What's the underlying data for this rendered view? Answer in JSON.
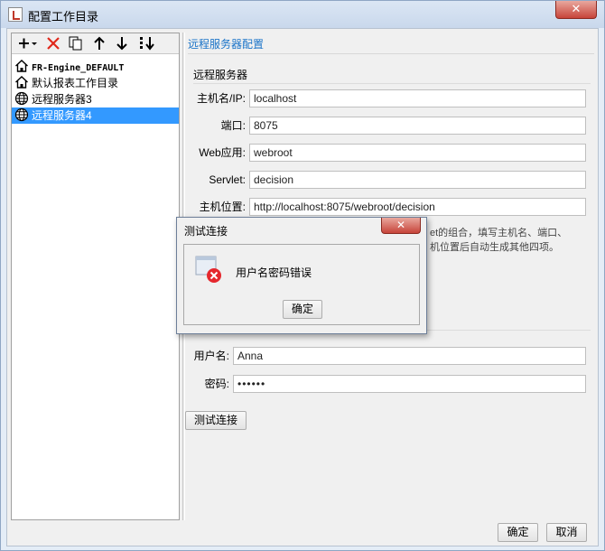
{
  "window": {
    "title": "配置工作目录",
    "close_glyph": "✕"
  },
  "toolbar": {
    "add_icon": "plus-icon",
    "delete_icon": "red-x-icon",
    "copy_icon": "copy-icon",
    "up_icon": "arrow-up-icon",
    "down_icon": "arrow-down-icon",
    "sort_icon": "sort-icon"
  },
  "tree": {
    "items": [
      {
        "label": "FR-Engine_DEFAULT",
        "icon": "home-icon"
      },
      {
        "label": "默认报表工作目录",
        "icon": "home-icon"
      },
      {
        "label": "远程服务器3",
        "icon": "globe-icon"
      },
      {
        "label": "远程服务器4",
        "icon": "globe-icon",
        "selected": true
      }
    ]
  },
  "config": {
    "section_title": "远程服务器配置",
    "server_group": "远程服务器",
    "hostname_label": "主机名/IP:",
    "hostname_value": "localhost",
    "port_label": "端口:",
    "port_value": "8075",
    "webapp_label": "Web应用:",
    "webapp_value": "webroot",
    "servlet_label": "Servlet:",
    "servlet_value": "decision",
    "location_label": "主机位置:",
    "location_value": "http://localhost:8075/webroot/decision",
    "hint_line1": "et的组合，填写主机名、端口、",
    "hint_line2": "机位置后自动生成其他四项。",
    "username_label": "用户名:",
    "username_value": "Anna",
    "password_label": "密码:",
    "password_value": "••••••",
    "test_button": "测试连接"
  },
  "footer": {
    "ok_button": "确定",
    "cancel_button": "取消"
  },
  "dialog": {
    "title": "测试连接",
    "close_glyph": "✕",
    "message": "用户名密码错误",
    "ok_button": "确定"
  }
}
